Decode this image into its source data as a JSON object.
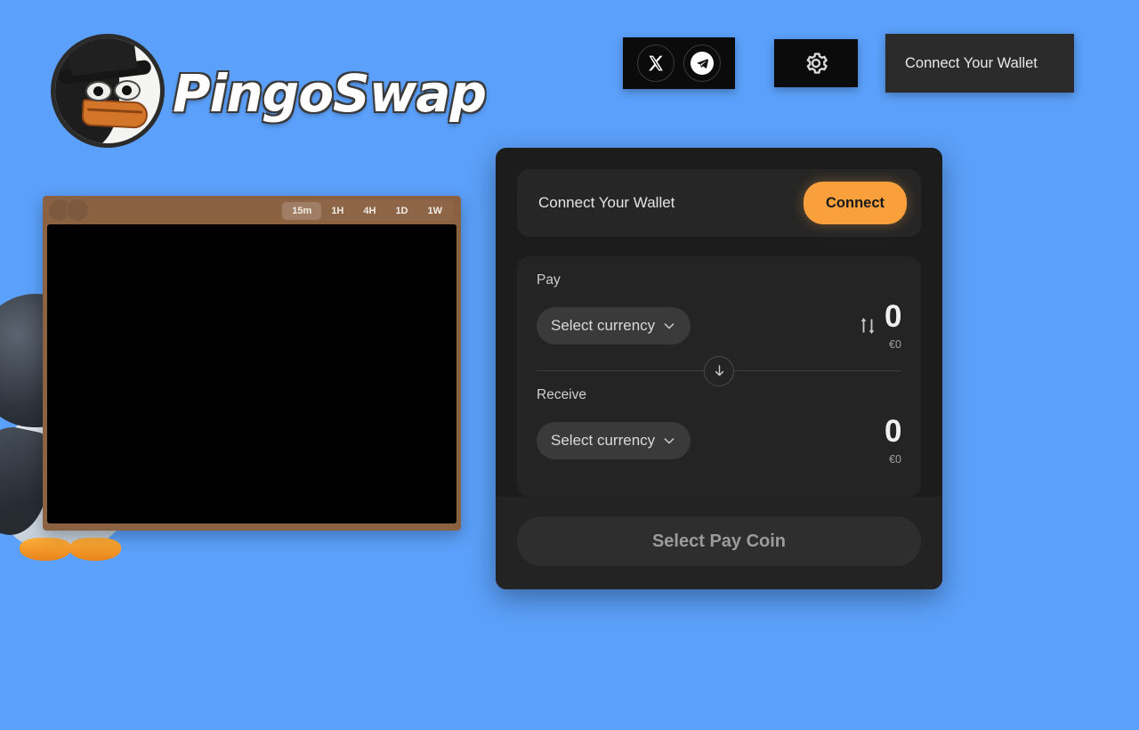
{
  "brand": {
    "name": "PingoSwap",
    "logo_icon": "penguin-logo-icon"
  },
  "header": {
    "socials": [
      {
        "icon": "x-twitter-icon",
        "label": "X"
      },
      {
        "icon": "telegram-icon",
        "label": "Telegram"
      }
    ],
    "settings_icon": "gear-icon",
    "connect_wallet_label": "Connect Your Wallet"
  },
  "chart": {
    "pair_icon_a": "token-icon-a",
    "pair_icon_b": "token-icon-b",
    "timeframes": [
      {
        "label": "15m",
        "active": true
      },
      {
        "label": "1H",
        "active": false
      },
      {
        "label": "4H",
        "active": false
      },
      {
        "label": "1D",
        "active": false
      },
      {
        "label": "1W",
        "active": false
      }
    ]
  },
  "swap": {
    "wallet_label": "Connect Your Wallet",
    "connect_label": "Connect",
    "pay": {
      "label": "Pay",
      "currency_placeholder": "Select currency",
      "chevron_icon": "chevron-down-icon",
      "toggle_icon": "up-down-arrows-icon",
      "amount": "0",
      "fiat": "€0"
    },
    "switch_icon": "arrow-down-icon",
    "receive": {
      "label": "Receive",
      "currency_placeholder": "Select currency",
      "chevron_icon": "chevron-down-icon",
      "amount": "0",
      "fiat": "€0"
    },
    "action_label": "Select Pay Coin"
  },
  "mascot": {
    "icon": "penguin-mascot-image"
  },
  "colors": {
    "background": "#5ba0fa",
    "accent": "#f9a03c",
    "card": "#1c1c1c",
    "chart_frame": "#8a6242"
  }
}
